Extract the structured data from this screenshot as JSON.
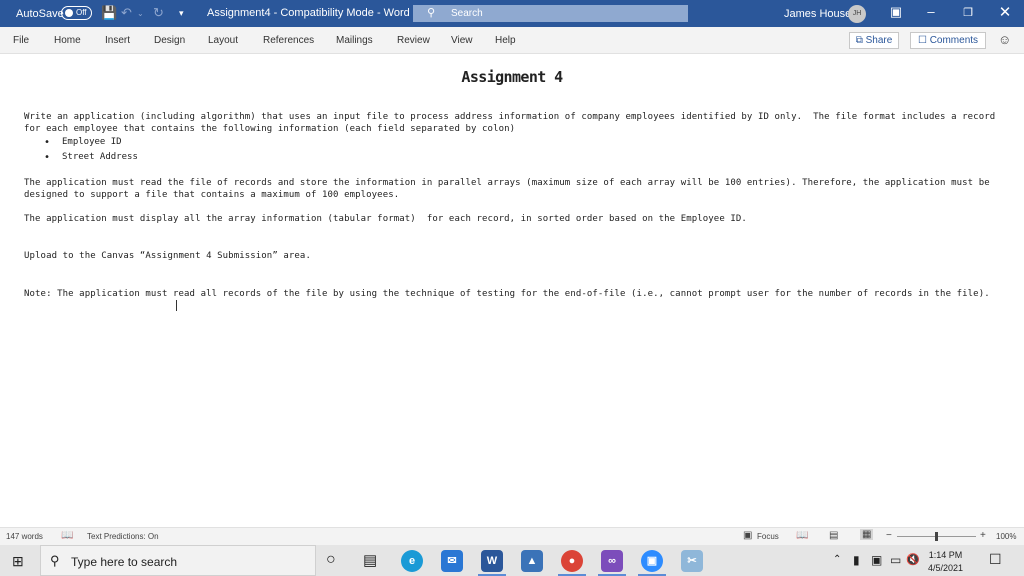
{
  "titlebar": {
    "autosave_label": "AutoSave",
    "autosave_state": "Off",
    "document_title": "Assignment4  -  Compatibility Mode  -  Word",
    "search_placeholder": "Search",
    "user_name": "James House",
    "user_initials": "JH"
  },
  "ribbon": {
    "tabs": [
      "File",
      "Home",
      "Insert",
      "Design",
      "Layout",
      "References",
      "Mailings",
      "Review",
      "View",
      "Help"
    ],
    "share_label": "Share",
    "comments_label": "Comments"
  },
  "document": {
    "title": "Assignment 4",
    "paragraph1": "Write an application (including algorithm) that uses an input file to process address information of company employees identified by ID only.  The file format includes a record for each employee that contains the following information (each field separated by colon)",
    "bullets": [
      "Employee ID",
      "Street Address"
    ],
    "paragraph2": "The application must read the file of records and store the information in parallel arrays (maximum size of each array will be 100 entries). Therefore, the application must be designed to support a file that contains a maximum of 100 employees.",
    "paragraph3": "The application must display all the array information (tabular format)  for each record, in sorted order based on the Employee ID.",
    "paragraph4": "Upload to the Canvas “Assignment 4 Submission” area.",
    "paragraph5": "Note: The application must read all records of the file by using the technique of testing for the end-of-file (i.e., cannot prompt user for the number of records in the file)."
  },
  "statusbar": {
    "word_count": "147 words",
    "text_predictions": "Text Predictions: On",
    "focus_label": "Focus",
    "zoom_minus": "−",
    "zoom_plus": "+",
    "zoom_level": "100%",
    "zoom_fraction": 0.5
  },
  "taskbar": {
    "search_placeholder": "Type here to search",
    "time": "1:14 PM",
    "date": "4/5/2021"
  },
  "colors": {
    "word_blue": "#2b579a",
    "search_box": "#8fa9d0",
    "ribbon_bg": "#f3f3f3",
    "taskbar_bg": "#e5e5e5"
  }
}
